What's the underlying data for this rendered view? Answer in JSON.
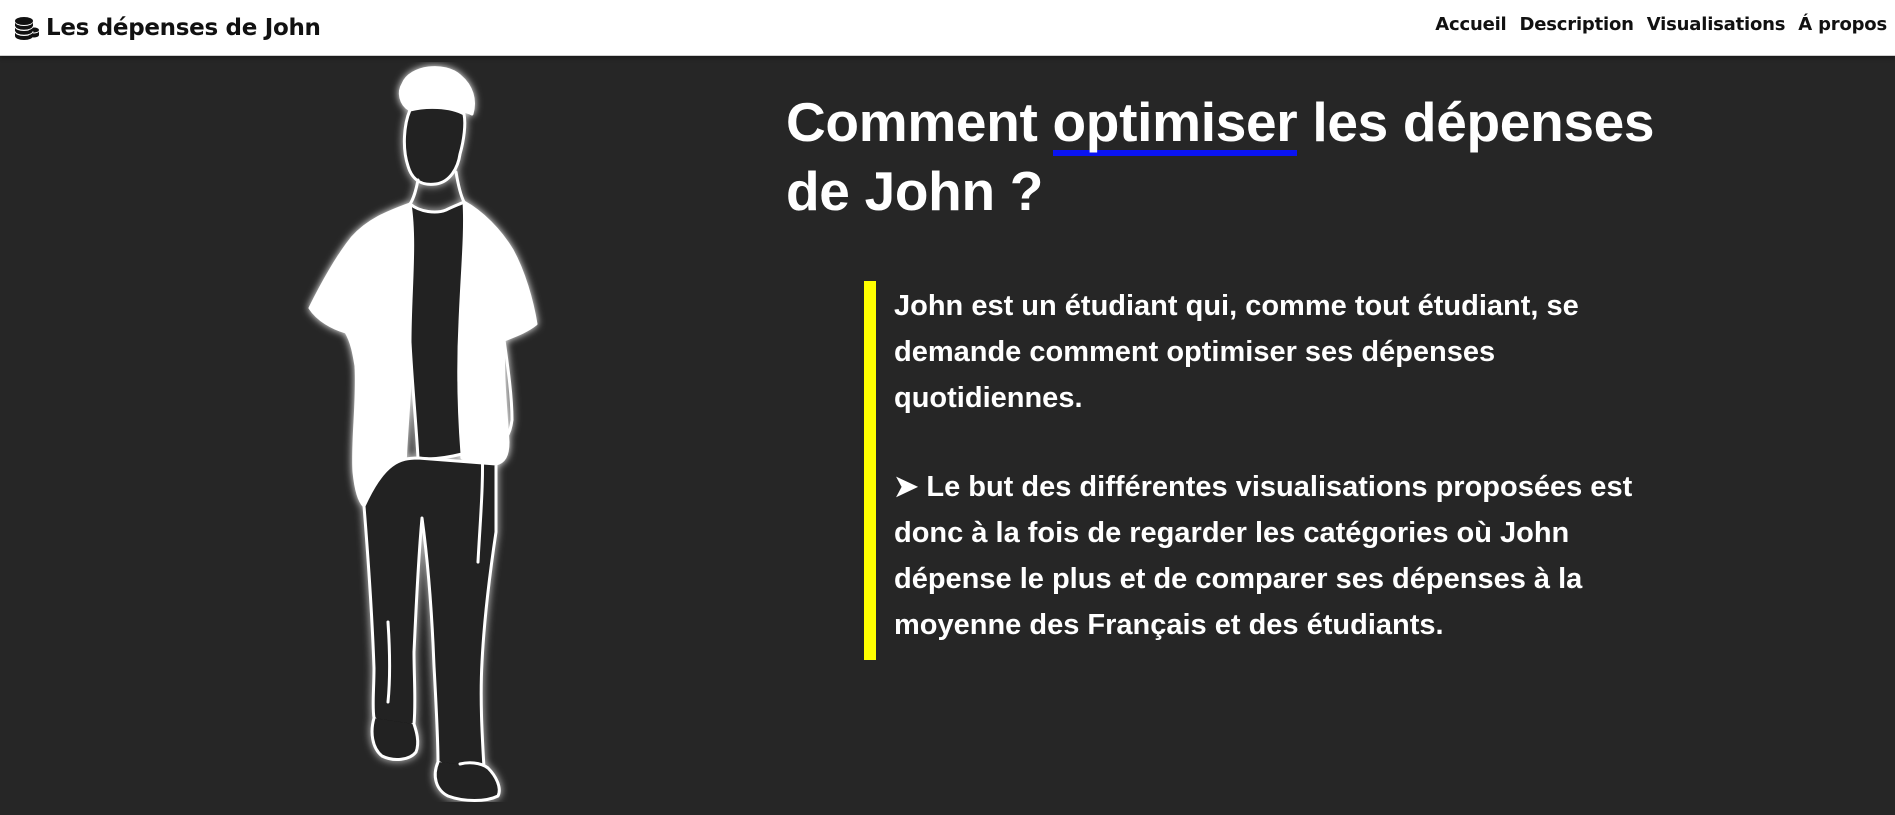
{
  "navbar": {
    "brand_icon": "coins-stack-icon",
    "brand_title": "Les dépenses de John",
    "links": [
      {
        "label": "Accueil"
      },
      {
        "label": "Description"
      },
      {
        "label": "Visualisations"
      },
      {
        "label": "Á propos"
      }
    ]
  },
  "hero": {
    "title_before": "Comment ",
    "title_highlight": "optimiser",
    "title_after": " les dépenses de John ?",
    "highlight_color": "#0a14f2",
    "image": "john-silhouette-illustration"
  },
  "description": {
    "paragraph_1": "John est un étudiant qui, comme tout étudiant, se demande comment optimiser ses dépenses quotidiennes.",
    "paragraph_2": "➤ Le but des différentes visualisations proposées est donc à la fois de regarder les catégories où John dépense le plus et de comparer ses dépenses à la moyenne des Français et des étudiants.",
    "accent_color": "#ffff00"
  },
  "colors": {
    "background": "#262626",
    "navbar": "#ffffff",
    "text": "#ffffff"
  }
}
